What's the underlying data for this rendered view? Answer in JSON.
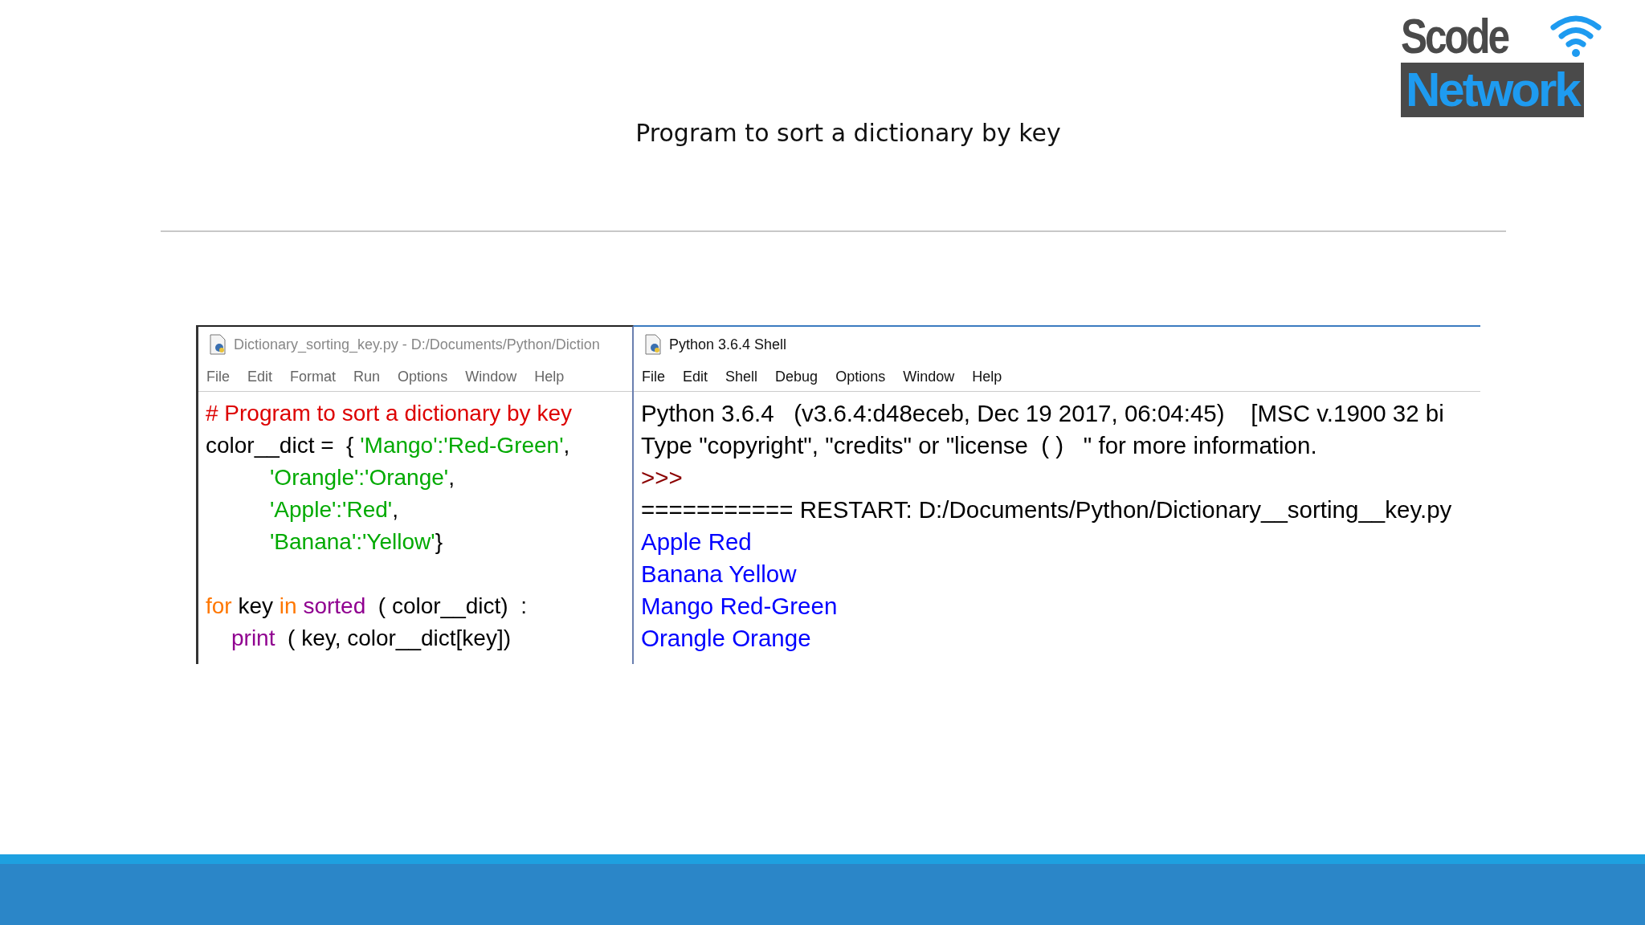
{
  "logo": {
    "top": "Scode",
    "bottom": "Network"
  },
  "slide_title": "Program to sort a dictionary by key",
  "editor": {
    "title": "Dictionary_sorting_key.py - D:/Documents/Python/Diction",
    "menu": [
      "File",
      "Edit",
      "Format",
      "Run",
      "Options",
      "Window",
      "Help"
    ],
    "lines": [
      {
        "kind": "code",
        "tokens": [
          {
            "text": "# Program to sort a dictionary by key",
            "kind": "comment"
          }
        ]
      },
      {
        "kind": "code",
        "tokens": [
          {
            "text": "color__dict =  { ",
            "kind": "plain"
          },
          {
            "text": "'Mango':'Red-Green'",
            "kind": "string"
          },
          {
            "text": ",",
            "kind": "plain"
          }
        ]
      },
      {
        "kind": "continuation",
        "tokens": [
          {
            "text": "'Orangle':'Orange'",
            "kind": "string"
          },
          {
            "text": ",",
            "kind": "plain"
          }
        ]
      },
      {
        "kind": "continuation",
        "tokens": [
          {
            "text": "'Apple':'Red'",
            "kind": "string"
          },
          {
            "text": ",",
            "kind": "plain"
          }
        ]
      },
      {
        "kind": "continuation",
        "tokens": [
          {
            "text": "'Banana':'Yellow'",
            "kind": "string"
          },
          {
            "text": "}",
            "kind": "plain"
          }
        ]
      },
      {
        "kind": "blank"
      },
      {
        "kind": "code",
        "tokens": [
          {
            "text": "for",
            "kind": "keyword"
          },
          {
            "text": " key ",
            "kind": "plain"
          },
          {
            "text": "in",
            "kind": "keyword"
          },
          {
            "text": " sorted",
            "kind": "builtin"
          },
          {
            "text": "  ( color__dict)  :",
            "kind": "plain"
          }
        ]
      },
      {
        "kind": "body",
        "tokens": [
          {
            "text": "print",
            "kind": "builtin"
          },
          {
            "text": "  ( key, color__dict[key])",
            "kind": "plain"
          }
        ]
      }
    ]
  },
  "shell": {
    "title": "Python 3.6.4 Shell",
    "menu": [
      "File",
      "Edit",
      "Shell",
      "Debug",
      "Options",
      "Window",
      "Help"
    ],
    "lines": [
      {
        "text": "Python 3.6.4   (v3.6.4:d48eceb, Dec 19 2017, 06:04:45)    [MSC v.1900 32 bi",
        "kind": "plain"
      },
      {
        "text": "Type \"copyright\", \"credits\" or \"license  ( )   \" for more information.",
        "kind": "plain"
      },
      {
        "text": ">>>",
        "kind": "prompt"
      },
      {
        "text": "=========== RESTART: D:/Documents/Python/Dictionary__sorting__key.py",
        "kind": "plain"
      },
      {
        "text": "Apple Red",
        "kind": "output"
      },
      {
        "text": "Banana Yellow",
        "kind": "output"
      },
      {
        "text": "Mango Red-Green",
        "kind": "output"
      },
      {
        "text": "Orangle Orange",
        "kind": "output"
      }
    ]
  }
}
